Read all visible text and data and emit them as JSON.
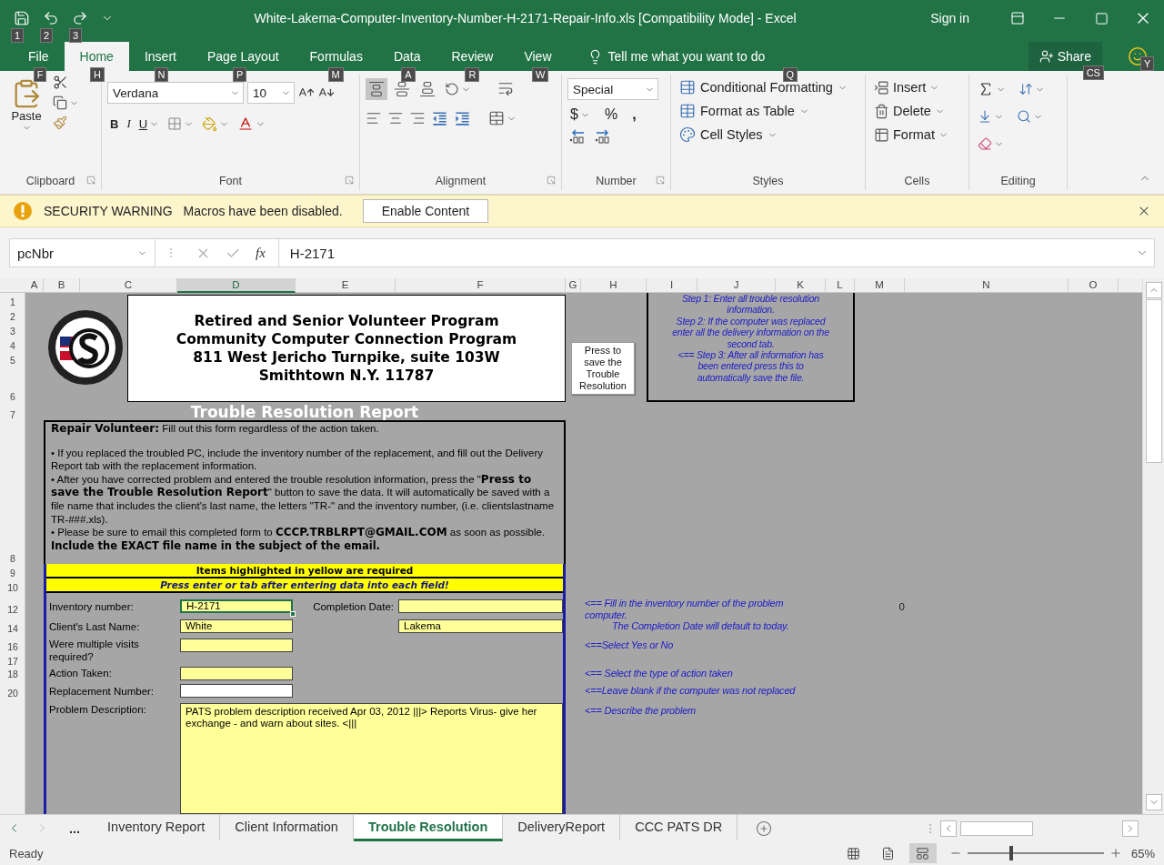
{
  "title_bar": {
    "quick_access_keytips": [
      "1",
      "2",
      "3"
    ],
    "title": "White-Lakema-Computer-Inventory-Number-H-2171-Repair-Info.xls  [Compatibility Mode]  -  Excel",
    "sign_in": "Sign in"
  },
  "ribbon_tabs": [
    {
      "label": "File",
      "keytip": "F",
      "selected": false
    },
    {
      "label": "Home",
      "keytip": "H",
      "selected": true
    },
    {
      "label": "Insert",
      "keytip": "N",
      "selected": false
    },
    {
      "label": "Page Layout",
      "keytip": "P",
      "selected": false
    },
    {
      "label": "Formulas",
      "keytip": "M",
      "selected": false
    },
    {
      "label": "Data",
      "keytip": "A",
      "selected": false
    },
    {
      "label": "Review",
      "keytip": "R",
      "selected": false
    },
    {
      "label": "View",
      "keytip": "W",
      "selected": false
    }
  ],
  "tell_me": {
    "placeholder": "Tell me what you want to do",
    "keytip": "Q"
  },
  "share": {
    "label": "Share",
    "keytip": "CS"
  },
  "account": {
    "keytip": "Y"
  },
  "ribbon": {
    "clipboard": {
      "label": "Clipboard",
      "paste": "Paste"
    },
    "font": {
      "label": "Font",
      "name": "Verdana",
      "size": "10",
      "bold": "B",
      "italic": "I",
      "underline": "U"
    },
    "alignment": {
      "label": "Alignment",
      "vertical": [
        {
          "selected": true
        },
        {
          "selected": false
        },
        {
          "selected": false
        }
      ]
    },
    "number": {
      "label": "Number",
      "format": "Special",
      "currency": "$",
      "percent": "%",
      "comma": ","
    },
    "styles": {
      "label": "Styles",
      "items": [
        "Conditional Formatting",
        "Format as Table",
        "Cell Styles"
      ]
    },
    "cells": {
      "label": "Cells",
      "items": [
        "Insert",
        "Delete",
        "Format"
      ]
    },
    "editing": {
      "label": "Editing"
    }
  },
  "security_bar": {
    "title": "SECURITY WARNING",
    "message": "Macros have been disabled.",
    "button": "Enable Content"
  },
  "formula_bar": {
    "name_box": "pcNbr",
    "function_label": "fx",
    "value": "H-2171"
  },
  "columns": [
    {
      "label": "A",
      "selected": false
    },
    {
      "label": "B",
      "selected": false
    },
    {
      "label": "C",
      "selected": false
    },
    {
      "label": "D",
      "selected": true
    },
    {
      "label": "E",
      "selected": false
    },
    {
      "label": "F",
      "selected": false
    },
    {
      "label": "G",
      "selected": false
    },
    {
      "label": "H",
      "selected": false
    },
    {
      "label": "I",
      "selected": false
    },
    {
      "label": "J",
      "selected": false
    },
    {
      "label": "K",
      "selected": false
    },
    {
      "label": "L",
      "selected": false
    },
    {
      "label": "M",
      "selected": false
    },
    {
      "label": "N",
      "selected": false
    },
    {
      "label": "O",
      "selected": false
    }
  ],
  "rows": [
    "1",
    "2",
    "3",
    "4",
    "5",
    "6",
    "7",
    "8",
    "9",
    "10",
    "12",
    "14",
    "16",
    "17",
    "18",
    "20"
  ],
  "header_block": {
    "lines": [
      "Retired and Senior Volunteer Program",
      "Community Computer Connection Program",
      "811 West Jericho Turnpike, suite 103W",
      "Smithtown N.Y. 11787"
    ]
  },
  "save_button": {
    "label": "Press to save the Trouble Resolution"
  },
  "steps": [
    "Step 1: Enter all trouble resolution information.",
    "Step 2: If the computer was replaced enter all the delivery information on the second tab.",
    "<== Step 3: After all information has been entered press this to automatically save the file."
  ],
  "report_title": "Trouble Resolution Report",
  "instructions": [
    {
      "kind": "lead",
      "text": "**Repair Volunteer:** Fill out this form regardless of the action taken."
    },
    {
      "kind": "bullet",
      "text": "• If you replaced the troubled PC, include the inventory number of the replacement, and fill out the Delivery Report tab with the replacement information."
    },
    {
      "kind": "bullet",
      "text": "• After you have corrected problem and entered the trouble resolution information, press the \"**Press to save the Trouble Resolution Report**\" button to save the data. It will automatically be saved with a file name that includes the client's last name, the letters \"TR-\" and the inventory number, (i.e. clientslastname TR-###.xls)."
    },
    {
      "kind": "bullet",
      "text": "• Please be sure to email this completed form to **CCCP.TRBLRPT@GMAIL.COM** as soon as possible."
    },
    {
      "kind": "footer",
      "text": "Include the EXACT file name in the subject of the email."
    }
  ],
  "banners": [
    {
      "kind": "required",
      "text": "Items highlighted in yellow are required"
    },
    {
      "kind": "tip",
      "text": "Press enter or tab after entering data into each field!"
    }
  ],
  "fields": [
    {
      "label": "Inventory number:",
      "value": "H-2171",
      "required": true,
      "selected": true
    },
    {
      "label": "Client's Last Name:",
      "value": "White",
      "required": true,
      "selected": false
    },
    {
      "label": "Were multiple visits required?",
      "required": true,
      "selected": false
    },
    {
      "label": "Action Taken:",
      "required": true,
      "selected": false
    },
    {
      "label": "Replacement Number:",
      "required": false,
      "selected": false
    },
    {
      "label": "Problem Description:",
      "value": "PATS problem description received Apr 03, 2012 |||> Reports Virus- give her exchange -  and warn about sites. <|||",
      "required": true,
      "selected": false
    }
  ],
  "completion_date": {
    "label": "Completion Date:",
    "required": true
  },
  "first_name": {
    "value": "Lakema",
    "required": true
  },
  "notes": [
    "<== Fill in the inventory number of the problem computer.",
    "The Completion Date will default to today.",
    "<==Select Yes or No",
    "<==  Select the type of action taken",
    "<==Leave blank if the computer was not replaced",
    "<== Describe the problem"
  ],
  "column_m_value": "0",
  "sheet_tabs": {
    "more": "...",
    "tabs": [
      {
        "label": "Inventory Report",
        "selected": false
      },
      {
        "label": "Client Information",
        "selected": false
      },
      {
        "label": "Trouble Resolution",
        "selected": true
      },
      {
        "label": "DeliveryReport",
        "selected": false
      },
      {
        "label": "CCC PATS DR",
        "selected": false
      }
    ]
  },
  "status_bar": {
    "text": "Ready",
    "views": [
      {
        "kind": "normal",
        "selected": false
      },
      {
        "kind": "layout",
        "selected": false
      },
      {
        "kind": "break",
        "selected": true
      }
    ],
    "zoom": {
      "level": 0.32,
      "label": "65%"
    }
  }
}
